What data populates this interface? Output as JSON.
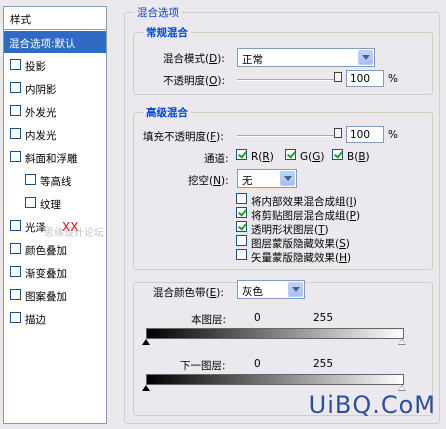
{
  "sidebar": {
    "header": "样式",
    "items": [
      {
        "label": "混合选项:默认",
        "selected": true,
        "checkbox": false,
        "checked": false
      },
      {
        "label": "投影",
        "checkbox": true,
        "checked": false
      },
      {
        "label": "内阴影",
        "checkbox": true,
        "checked": false
      },
      {
        "label": "外发光",
        "checkbox": true,
        "checked": false
      },
      {
        "label": "内发光",
        "checkbox": true,
        "checked": false
      },
      {
        "label": "斜面和浮雕",
        "checkbox": true,
        "checked": false
      },
      {
        "label": "等高线",
        "checkbox": true,
        "checked": false,
        "indent": true
      },
      {
        "label": "纹理",
        "checkbox": true,
        "checked": false,
        "indent": true
      },
      {
        "label": "光泽",
        "checkbox": true,
        "checked": false
      },
      {
        "label": "颜色叠加",
        "checkbox": true,
        "checked": false
      },
      {
        "label": "渐变叠加",
        "checkbox": true,
        "checked": false
      },
      {
        "label": "图案叠加",
        "checkbox": true,
        "checked": false
      },
      {
        "label": "描边",
        "checkbox": true,
        "checked": false
      }
    ]
  },
  "blending_options": {
    "title": "混合选项",
    "general": {
      "title": "常规混合",
      "blend_mode_label": "混合模式(",
      "blend_mode_key": "D",
      "blend_mode_value": "正常",
      "opacity_label": "不透明度(",
      "opacity_key": "O",
      "opacity_value": "100",
      "opacity_unit": "%"
    },
    "advanced": {
      "title": "高级混合",
      "fill_label": "填充不透明度(",
      "fill_key": "F",
      "fill_value": "100",
      "fill_unit": "%",
      "channels_label": "通道:",
      "channel_r": "R(",
      "channel_r_key": "R",
      "channel_g": "G(",
      "channel_g_key": "G",
      "channel_b": "B(",
      "channel_b_key": "B",
      "knockout_label": "挖空(",
      "knockout_key": "N",
      "knockout_value": "无",
      "options": [
        {
          "label": "将内部效果混合成组(",
          "key": "I",
          "checked": false
        },
        {
          "label": "将剪贴图层混合成组(",
          "key": "P",
          "checked": true
        },
        {
          "label": "透明形状图层(",
          "key": "T",
          "checked": true
        },
        {
          "label": "图层蒙版隐藏效果(",
          "key": "S",
          "checked": false
        },
        {
          "label": "矢量蒙版隐藏效果(",
          "key": "H",
          "checked": false
        }
      ]
    },
    "blend_if": {
      "label": "混合颜色带(",
      "key": "E",
      "value": "灰色",
      "this_layer_label": "本图层:",
      "this_layer_min": "0",
      "this_layer_max": "255",
      "underlying_label": "下一图层:",
      "underlying_min": "0",
      "underlying_max": "255"
    }
  },
  "watermark": "UiBQ.CoM",
  "overlay_red": "XX",
  "overlay_ghost": "思缘设计论坛"
}
